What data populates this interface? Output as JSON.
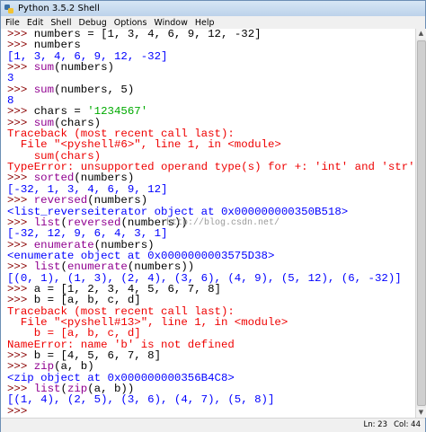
{
  "window": {
    "title": "Python 3.5.2 Shell"
  },
  "menu": [
    "File",
    "Edit",
    "Shell",
    "Debug",
    "Options",
    "Window",
    "Help"
  ],
  "shell": {
    "lines": [
      {
        "segs": [
          {
            "t": ">>> ",
            "c": "prompt"
          },
          {
            "t": "numbers = [1, 3, 4, 6, 9, 12, -32]",
            "c": ""
          }
        ]
      },
      {
        "segs": [
          {
            "t": ">>> ",
            "c": "prompt"
          },
          {
            "t": "numbers",
            "c": ""
          }
        ]
      },
      {
        "segs": [
          {
            "t": "[1, 3, 4, 6, 9, 12, -32]",
            "c": "out"
          }
        ]
      },
      {
        "segs": [
          {
            "t": ">>> ",
            "c": "prompt"
          },
          {
            "t": "sum",
            "c": "bi"
          },
          {
            "t": "(numbers)",
            "c": ""
          }
        ]
      },
      {
        "segs": [
          {
            "t": "3",
            "c": "out"
          }
        ]
      },
      {
        "segs": [
          {
            "t": ">>> ",
            "c": "prompt"
          },
          {
            "t": "sum",
            "c": "bi"
          },
          {
            "t": "(numbers, 5)",
            "c": ""
          }
        ]
      },
      {
        "segs": [
          {
            "t": "8",
            "c": "out"
          }
        ]
      },
      {
        "segs": [
          {
            "t": ">>> ",
            "c": "prompt"
          },
          {
            "t": "chars = ",
            "c": ""
          },
          {
            "t": "'1234567'",
            "c": "str"
          }
        ]
      },
      {
        "segs": [
          {
            "t": ">>> ",
            "c": "prompt"
          },
          {
            "t": "sum",
            "c": "bi"
          },
          {
            "t": "(chars)",
            "c": ""
          }
        ]
      },
      {
        "segs": [
          {
            "t": "Traceback (most recent call last):",
            "c": "err"
          }
        ]
      },
      {
        "segs": [
          {
            "t": "  File \"<pyshell#6>\", line 1, in <module>",
            "c": "err"
          }
        ]
      },
      {
        "segs": [
          {
            "t": "    sum(chars)",
            "c": "err"
          }
        ]
      },
      {
        "segs": [
          {
            "t": "TypeError: unsupported operand type(s) for +: 'int' and 'str'",
            "c": "err"
          }
        ]
      },
      {
        "segs": [
          {
            "t": ">>> ",
            "c": "prompt"
          },
          {
            "t": "sorted",
            "c": "bi"
          },
          {
            "t": "(numbers)",
            "c": ""
          }
        ]
      },
      {
        "segs": [
          {
            "t": "[-32, 1, 3, 4, 6, 9, 12]",
            "c": "out"
          }
        ]
      },
      {
        "segs": [
          {
            "t": ">>> ",
            "c": "prompt"
          },
          {
            "t": "reversed",
            "c": "bi"
          },
          {
            "t": "(numbers)",
            "c": ""
          }
        ]
      },
      {
        "segs": [
          {
            "t": "<list_reverseiterator object at 0x000000000350B518>",
            "c": "out"
          }
        ]
      },
      {
        "segs": [
          {
            "t": ">>> ",
            "c": "prompt"
          },
          {
            "t": "list",
            "c": "bi"
          },
          {
            "t": "(",
            "c": ""
          },
          {
            "t": "reversed",
            "c": "bi"
          },
          {
            "t": "(numbers))",
            "c": ""
          }
        ]
      },
      {
        "segs": [
          {
            "t": "[-32, 12, 9, 6, 4, 3, 1]",
            "c": "out"
          }
        ]
      },
      {
        "segs": [
          {
            "t": ">>> ",
            "c": "prompt"
          },
          {
            "t": "enumerate",
            "c": "bi"
          },
          {
            "t": "(numbers)",
            "c": ""
          }
        ]
      },
      {
        "segs": [
          {
            "t": "<enumerate object at 0x0000000003575D38>",
            "c": "out"
          }
        ]
      },
      {
        "segs": [
          {
            "t": ">>> ",
            "c": "prompt"
          },
          {
            "t": "list",
            "c": "bi"
          },
          {
            "t": "(",
            "c": ""
          },
          {
            "t": "enumerate",
            "c": "bi"
          },
          {
            "t": "(numbers))",
            "c": ""
          }
        ]
      },
      {
        "segs": [
          {
            "t": "[(0, 1), (1, 3), (2, 4), (3, 6), (4, 9), (5, 12), (6, -32)]",
            "c": "out"
          }
        ]
      },
      {
        "segs": [
          {
            "t": ">>> ",
            "c": "prompt"
          },
          {
            "t": "a = [1, 2, 3, 4, 5, 6, 7, 8]",
            "c": ""
          }
        ]
      },
      {
        "segs": [
          {
            "t": ">>> ",
            "c": "prompt"
          },
          {
            "t": "b = [a, b, c, d]",
            "c": ""
          }
        ]
      },
      {
        "segs": [
          {
            "t": "Traceback (most recent call last):",
            "c": "err"
          }
        ]
      },
      {
        "segs": [
          {
            "t": "  File \"<pyshell#13>\", line 1, in <module>",
            "c": "err"
          }
        ]
      },
      {
        "segs": [
          {
            "t": "    b = [a, b, c, d]",
            "c": "err"
          }
        ]
      },
      {
        "segs": [
          {
            "t": "NameError: name 'b' is not defined",
            "c": "err"
          }
        ]
      },
      {
        "segs": [
          {
            "t": ">>> ",
            "c": "prompt"
          },
          {
            "t": "b = [4, 5, 6, 7, 8]",
            "c": ""
          }
        ]
      },
      {
        "segs": [
          {
            "t": ">>> ",
            "c": "prompt"
          },
          {
            "t": "zip",
            "c": "bi"
          },
          {
            "t": "(a, b)",
            "c": ""
          }
        ]
      },
      {
        "segs": [
          {
            "t": "<zip object at 0x000000000356B4C8>",
            "c": "out"
          }
        ]
      },
      {
        "segs": [
          {
            "t": ">>> ",
            "c": "prompt"
          },
          {
            "t": "list",
            "c": "bi"
          },
          {
            "t": "(",
            "c": ""
          },
          {
            "t": "zip",
            "c": "bi"
          },
          {
            "t": "(a, b))",
            "c": ""
          }
        ]
      },
      {
        "segs": [
          {
            "t": "[(1, 4), (2, 5), (3, 6), (4, 7), (5, 8)]",
            "c": "out"
          }
        ]
      },
      {
        "segs": [
          {
            "t": ">>> ",
            "c": "prompt"
          }
        ]
      }
    ]
  },
  "watermark": "http://blog.csdn.net/",
  "status": {
    "line": "Ln: 23",
    "col": "Col: 44"
  },
  "colors": {
    "prompt": "#8a0000",
    "output": "#0000ff",
    "error": "#ee0000",
    "builtin": "#900090",
    "string": "#00aa00"
  }
}
